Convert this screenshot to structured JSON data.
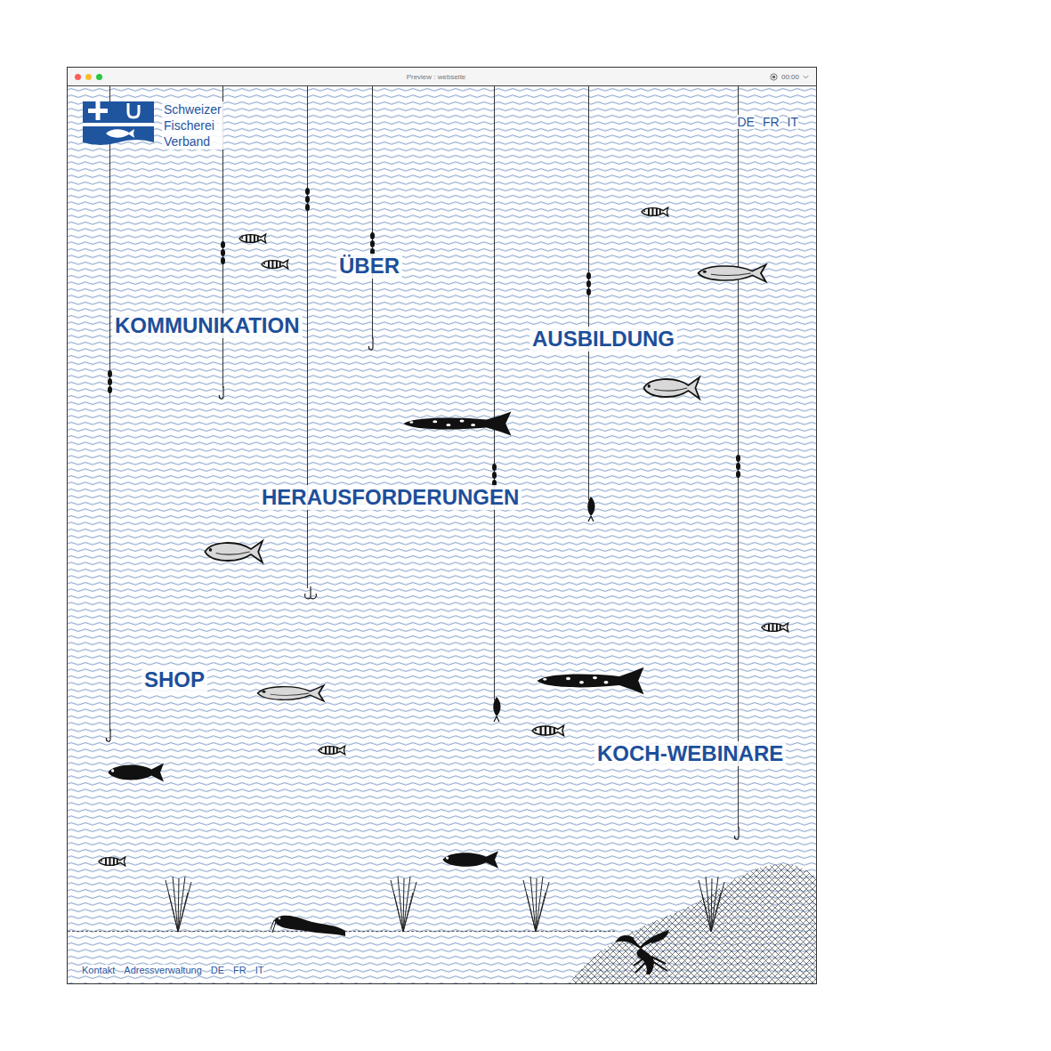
{
  "window": {
    "title": "Preview : webseite",
    "time": "00:00"
  },
  "logo": {
    "lines": [
      "Schweizer",
      "Fischerei",
      "Verband"
    ]
  },
  "header_languages": [
    "DE",
    "FR",
    "IT"
  ],
  "nav": [
    "ÜBER",
    "KOMMUNIKATION",
    "AUSBILDUNG",
    "HERAUSFORDERUNGEN",
    "SHOP",
    "KOCH-WEBINARE"
  ],
  "footer": {
    "links": [
      "Kontakt",
      "Adressverwaltung"
    ],
    "languages": [
      "DE",
      "FR",
      "IT"
    ]
  }
}
